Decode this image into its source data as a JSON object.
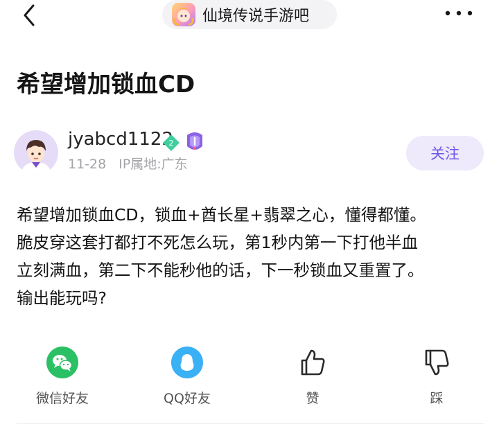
{
  "forum": {
    "name": "仙境传说手游吧"
  },
  "post": {
    "title": "希望增加锁血CD",
    "author": {
      "name": "jyabcd1122",
      "level": "2"
    },
    "date": "11-28",
    "ip_location": "IP属地:广东",
    "content_lines": [
      "希望增加锁血CD，锁血+酋长星+翡翠之心，懂得都懂。",
      "脆皮穿这套打都打不死怎么玩，第1秒内第一下打他半血",
      "立刻满血，第二下不能秒他的话，下一秒锁血又重置了。",
      "输出能玩吗?"
    ]
  },
  "buttons": {
    "follow": "关注"
  },
  "share": [
    {
      "label": "微信好友",
      "icon": "wechat-icon",
      "color": "#2bc064"
    },
    {
      "label": "QQ好友",
      "icon": "qq-icon",
      "color": "#3ab0f5"
    },
    {
      "label": "赞",
      "icon": "thumbs-up-icon"
    },
    {
      "label": "踩",
      "icon": "thumbs-down-icon"
    }
  ]
}
